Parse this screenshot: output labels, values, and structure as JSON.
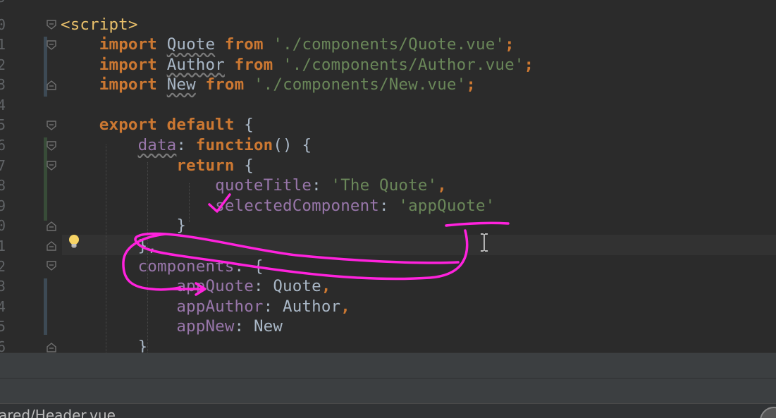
{
  "gutter": {
    "line_numbers": [
      "9",
      "0",
      "1",
      "2",
      "3",
      "4",
      "5",
      "6",
      "7",
      "8",
      "9",
      "0",
      "1",
      "2",
      "3",
      "4",
      "5",
      "6"
    ]
  },
  "code": {
    "script_tag": "<script>",
    "import_kw": "import",
    "from_kw": "from",
    "imports": [
      {
        "name": "Quote",
        "path": "'./components/Quote.vue'"
      },
      {
        "name": "Author",
        "path": "'./components/Author.vue'"
      },
      {
        "name": "New",
        "path": "'./components/New.vue'"
      }
    ],
    "semicolon": ";",
    "export_kw": "export default",
    "open_brace": " {",
    "data_prop": "data",
    "function_kw": "function",
    "fn_parens": "() {",
    "return_kw": "return",
    "quote_title_key": "quoteTitle",
    "quote_title_value": "'The Quote'",
    "selected_key": "selectedComponent",
    "selected_value": "'appQuote'",
    "close_brace": "}",
    "close_brace_comma": "},",
    "components_prop": "components",
    "components_list": [
      {
        "key": "appQuote",
        "value": "Quote",
        "trail": ","
      },
      {
        "key": "appAuthor",
        "value": "Author",
        "trail": ","
      },
      {
        "key": "appNew",
        "value": "New",
        "trail": ""
      }
    ],
    "colon": ": ",
    "comma": ","
  },
  "status": {
    "file_path": "ared/Header.vue"
  },
  "colors": {
    "background": "#2b2b2b",
    "keyword": "#cc7832",
    "string": "#6a8759",
    "property": "#9876aa",
    "tag": "#e8bf6a",
    "annotation": "#ff22dd"
  },
  "icons": {
    "lightbulb": "lightbulb-icon",
    "fold": "fold-marker-icon",
    "text_cursor": "text-cursor-icon"
  }
}
